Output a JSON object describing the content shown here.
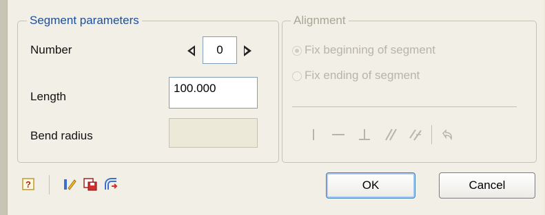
{
  "segment": {
    "legend": "Segment parameters",
    "number_label": "Number",
    "number_value": "0",
    "length_label": "Length",
    "length_value": "100.000",
    "bend_label": "Bend radius",
    "bend_value": ""
  },
  "alignment": {
    "legend": "Alignment",
    "option_begin": "Fix beginning of segment",
    "option_end": "Fix ending of segment",
    "selected": "option_begin",
    "tools": [
      "vertical-line-icon",
      "horizontal-line-icon",
      "perpendicular-icon",
      "parallel-icon",
      "angled-parallel-icon",
      "undo-icon"
    ]
  },
  "toolbar_icons": [
    "help-icon",
    "edit-icon",
    "save-icon",
    "rebuild-icon"
  ],
  "buttons": {
    "ok": "OK",
    "cancel": "Cancel"
  },
  "colors": {
    "group_border": "#c6c3b4",
    "legend_blue": "#1a4f9a",
    "disabled_text": "#b8b5a8",
    "default_button_ring": "#a9c8f5"
  }
}
